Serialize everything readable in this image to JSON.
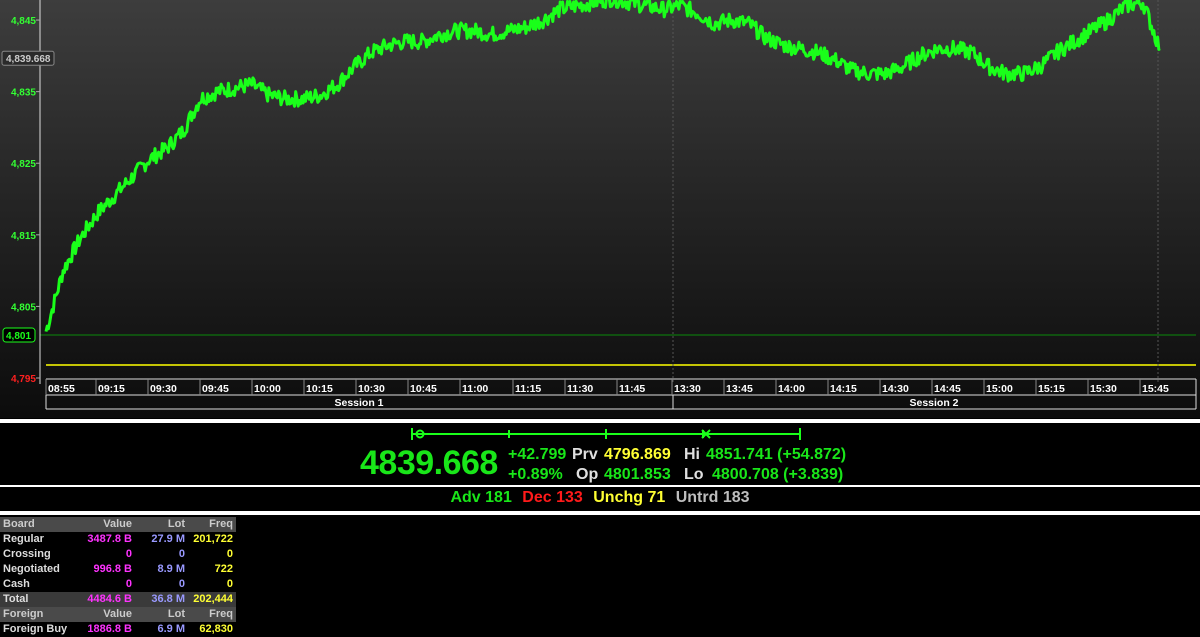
{
  "chart": {
    "y_ticks": [
      "4,845",
      "4,835",
      "4,825",
      "4,815",
      "4,805",
      "4,795"
    ],
    "last_label": "4,839.668",
    "open_label": "4,801",
    "x_ticks": [
      "08:55",
      "09:15",
      "09:30",
      "09:45",
      "10:00",
      "10:15",
      "10:30",
      "10:45",
      "11:00",
      "11:15",
      "11:30",
      "11:45",
      "13:30",
      "13:45",
      "14:00",
      "14:15",
      "14:30",
      "14:45",
      "15:00",
      "15:15",
      "15:30",
      "15:45"
    ],
    "sessions": [
      "Session 1",
      "Session 2"
    ],
    "colors": {
      "line": "#1aff1a",
      "prev_close": "#ffff00",
      "axis_text": "#33ff33"
    }
  },
  "chart_data": {
    "type": "line",
    "title": "",
    "xlabel": "",
    "ylabel": "",
    "ylim": [
      4795,
      4848
    ],
    "series": [
      {
        "x": [
          "08:55",
          "09:00",
          "09:05",
          "09:10",
          "09:15",
          "09:20",
          "09:25",
          "09:30",
          "09:35",
          "09:40",
          "09:45",
          "09:50",
          "09:55",
          "10:00",
          "10:05",
          "10:10",
          "10:15",
          "10:20",
          "10:25",
          "10:30",
          "10:35",
          "10:40",
          "10:45",
          "10:50",
          "10:55",
          "11:00",
          "11:05",
          "11:10",
          "11:15",
          "11:20",
          "11:25",
          "11:30",
          "11:35",
          "11:40",
          "11:45",
          "11:50",
          "11:55",
          "13:30",
          "13:35",
          "13:40",
          "13:45",
          "13:50",
          "13:55",
          "14:00",
          "14:05",
          "14:10",
          "14:15",
          "14:20",
          "14:25",
          "14:30",
          "14:35",
          "14:40",
          "14:45",
          "14:50",
          "14:55",
          "15:00",
          "15:05",
          "15:10",
          "15:15",
          "15:20",
          "15:25",
          "15:30",
          "15:35",
          "15:40",
          "15:45",
          "15:50"
        ],
        "values": [
          4801.5,
          4810,
          4814.5,
          4818,
          4820.5,
          4823,
          4825.5,
          4827,
          4829.5,
          4834,
          4835,
          4835.5,
          4836,
          4834.5,
          4834,
          4834,
          4834.5,
          4836,
          4838.5,
          4840.5,
          4841.5,
          4842,
          4842,
          4843,
          4843.5,
          4843.5,
          4843,
          4843.5,
          4844,
          4845,
          4846.5,
          4847,
          4847.5,
          4848,
          4847.5,
          4847,
          4846.5,
          4847,
          4846,
          4844.5,
          4845,
          4844.5,
          4842.5,
          4841.5,
          4841,
          4840.5,
          4839.5,
          4838,
          4837.5,
          4837.5,
          4838.5,
          4840,
          4841,
          4841,
          4840.5,
          4838.5,
          4837.5,
          4837.5,
          4838.5,
          4840.5,
          4842,
          4843.5,
          4845,
          4847,
          4847.5,
          4841
        ]
      }
    ],
    "reference_lines": {
      "open": 4801,
      "previous": 4796.869
    }
  },
  "quote": {
    "last": "4839.668",
    "change": "+42.799",
    "change_pct": "+0.89%",
    "prv_label": "Prv",
    "prv_value": "4796.869",
    "op_label": "Op",
    "op_value": "4801.853",
    "hi_label": "Hi",
    "hi_value": "4851.741 (+54.872)",
    "lo_label": "Lo",
    "lo_value": "4800.708 (+3.839)"
  },
  "breadth": {
    "adv": "Adv 181",
    "dec": "Dec 133",
    "unchg": "Unchg 71",
    "untrd": "Untrd 183"
  },
  "board": {
    "header": {
      "c0": "Board",
      "c1": "Value",
      "c2": "Lot",
      "c3": "Freq"
    },
    "rows": [
      {
        "c0": "Regular",
        "c1": "3487.8 B",
        "c2": "27.9 M",
        "c3": "201,722"
      },
      {
        "c0": "Crossing",
        "c1": "0",
        "c2": "0",
        "c3": "0"
      },
      {
        "c0": "Negotiated",
        "c1": "996.8 B",
        "c2": "8.9 M",
        "c3": "722"
      },
      {
        "c0": "Cash",
        "c1": "0",
        "c2": "0",
        "c3": "0"
      }
    ],
    "total": {
      "c0": "Total",
      "c1": "4484.6 B",
      "c2": "36.8 M",
      "c3": "202,444"
    },
    "foreign_header": {
      "c0": "Foreign",
      "c1": "Value",
      "c2": "Lot",
      "c3": "Freq"
    },
    "foreign_rows": [
      {
        "c0": "Foreign Buy",
        "c1": "1886.8 B",
        "c2": "6.9 M",
        "c3": "62,830"
      }
    ]
  }
}
